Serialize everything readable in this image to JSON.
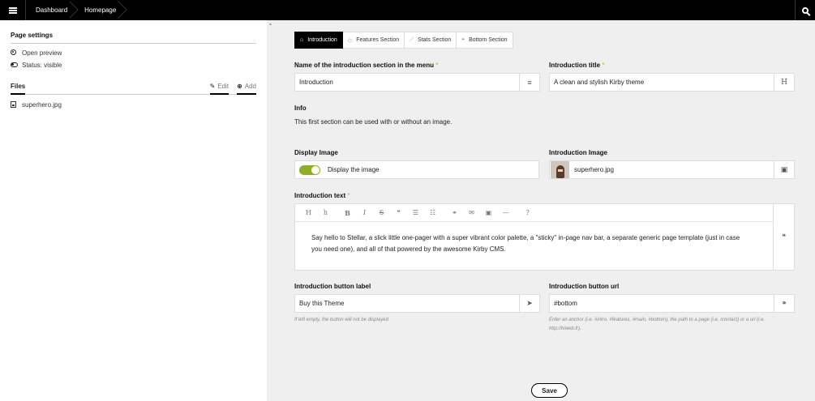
{
  "topbar": {
    "breadcrumbs": [
      "Dashboard",
      "Homepage"
    ]
  },
  "sidebar": {
    "page_settings_title": "Page settings",
    "open_preview": "Open preview",
    "status": "Status: visible",
    "files_title": "Files",
    "edit_label": "Edit",
    "add_label": "Add",
    "files": [
      "superhero.jpg"
    ]
  },
  "tabs": [
    {
      "label": "Introduction",
      "active": true
    },
    {
      "label": "Features Section",
      "active": false
    },
    {
      "label": "Stats Section",
      "active": false
    },
    {
      "label": "Bottom Section",
      "active": false
    }
  ],
  "form": {
    "menu_name_label": "Name of the introduction section in the menu",
    "menu_name_value": "Introduction",
    "title_label": "Introduction title",
    "title_value": "A clean and stylish Kirby theme",
    "info_label": "Info",
    "info_text": "This first section can be used with or without an image.",
    "display_image_label": "Display Image",
    "display_image_toggle_text": "Display the image",
    "display_image_on": true,
    "intro_image_label": "Introduction Image",
    "intro_image_value": "superhero.jpg",
    "intro_text_label": "Introduction text",
    "intro_text_value": "Say hello to Stellar, a slick little one-pager with a super vibrant color palette, a \"sticky\" in-page nav bar, a separate generic page template (just in case you need one), and all of that powered by the awesome Kirby CMS.",
    "button_label_label": "Introduction button label",
    "button_label_value": "Buy this Theme",
    "button_label_help": "If left empty, the button will not be displayed",
    "button_url_label": "Introduction button url",
    "button_url_value": "#bottom",
    "button_url_help": "Enter an anchor (i.e. #intro, #features, #main, #bottom), the path to a page (i.e. /contact) or a url (i.e. http://hiweb.fr).",
    "required_mark": "*",
    "save_label": "Save"
  },
  "colors": {
    "toggle_on": "#8dae28",
    "required": "#e8a100",
    "topbar": "#000000"
  }
}
